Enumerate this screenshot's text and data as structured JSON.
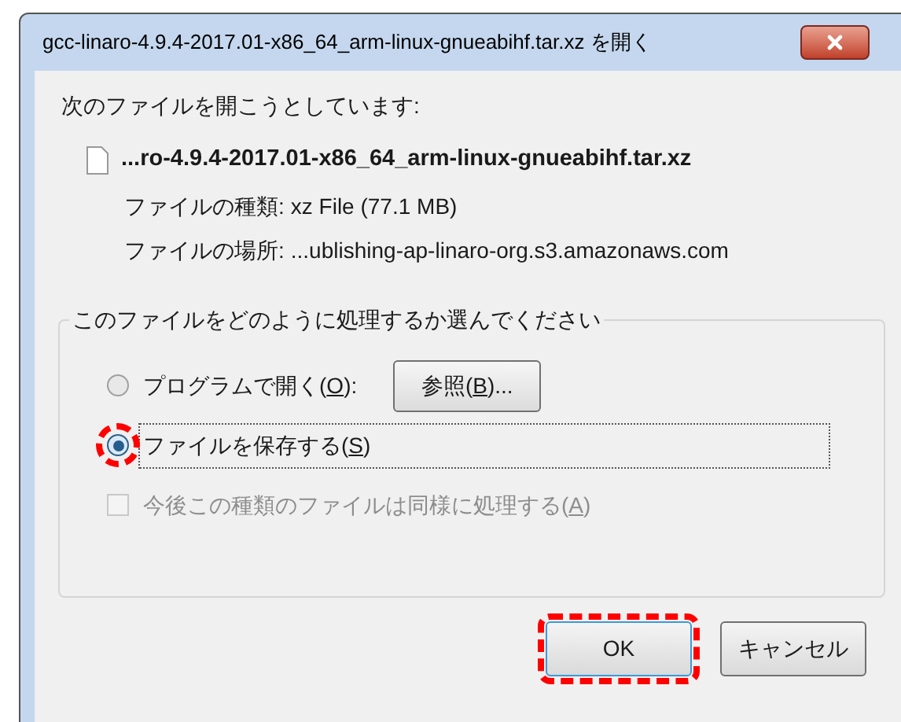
{
  "window": {
    "title": "gcc-linaro-4.9.4-2017.01-x86_64_arm-linux-gnueabihf.tar.xz を開く"
  },
  "intro": "次のファイルを開こうとしています:",
  "file": {
    "name": "...ro-4.9.4-2017.01-x86_64_arm-linux-gnueabihf.tar.xz",
    "details": [
      {
        "label": "ファイルの種類:",
        "value": "xz File (77.1 MB)"
      },
      {
        "label": "ファイルの場所:",
        "value": "...ublishing-ap-linaro-org.s3.amazonaws.com"
      }
    ]
  },
  "group": {
    "legend": "このファイルをどのように処理するか選んでください",
    "options": [
      {
        "kind": "radio",
        "before": "プログラムで開く(",
        "key": "O",
        "after": "):",
        "selected": false,
        "annotated": false,
        "browse": {
          "before": "参照(",
          "key": "B",
          "after": ")..."
        }
      },
      {
        "kind": "radio",
        "before": "ファイルを保存する(",
        "key": "S",
        "after": ")",
        "selected": true,
        "annotated": true
      },
      {
        "kind": "checkbox",
        "before": "今後この種類のファイルは同様に処理する(",
        "key": "A",
        "after": ")",
        "checked": false,
        "disabled": true
      }
    ]
  },
  "buttons": [
    {
      "label": "OK",
      "default": true,
      "annotated": true
    },
    {
      "label": "キャンセル",
      "default": false,
      "annotated": false
    }
  ]
}
